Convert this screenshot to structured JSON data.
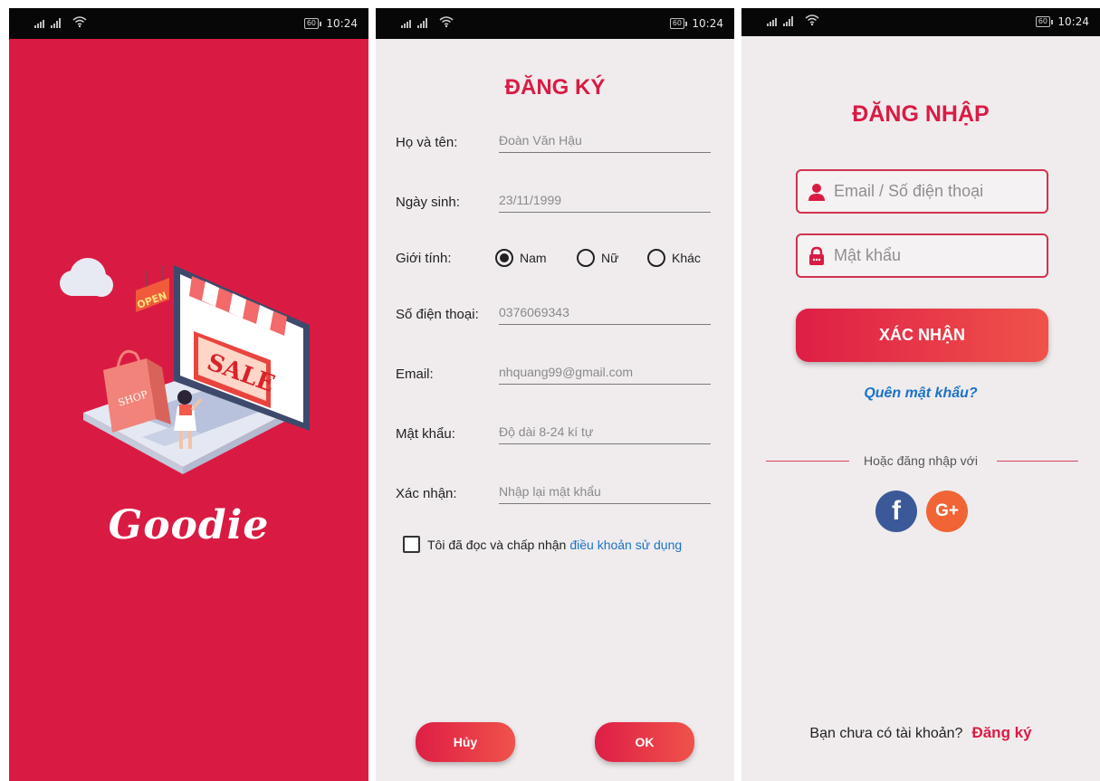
{
  "status": {
    "time": "10:24",
    "battery": "60"
  },
  "splash": {
    "brand": "Goodie",
    "sign_open": "OPEN",
    "sign_sale": "SALE",
    "bag_label": "SHOP"
  },
  "register": {
    "title": "ĐĂNG KÝ",
    "fields": [
      {
        "label": "Họ và tên:",
        "value": "Đoàn Văn Hậu"
      },
      {
        "label": "Ngày sinh:",
        "value": "23/11/1999"
      },
      {
        "label": "Số điện thoại:",
        "value": "0376069343"
      },
      {
        "label": "Email:",
        "value": "nhquang99@gmail.com"
      },
      {
        "label": "Mật khẩu:",
        "value": "Độ dài 8-24 kí tự"
      },
      {
        "label": "Xác nhận:",
        "value": "Nhập lại mật khẩu"
      }
    ],
    "gender_label": "Giới tính:",
    "gender_options": [
      "Nam",
      "Nữ",
      "Khác"
    ],
    "terms_text": "Tôi đã đọc và chấp nhận",
    "terms_link": "điều khoản sử dụng",
    "cancel_label": "Hủy",
    "ok_label": "OK"
  },
  "login": {
    "title": "ĐĂNG NHẬP",
    "email_placeholder": "Email / Số điện thoại",
    "password_placeholder": "Mật khẩu",
    "submit_label": "XÁC NHẬN",
    "forgot_label": "Quên mật khẩu?",
    "or_label": "Hoặc đăng nhập với",
    "facebook_label": "f",
    "google_label": "G+",
    "no_account": "Bạn chưa có tài khoản?",
    "register_link": "Đăng ký"
  },
  "colors": {
    "primary": "#d91b44",
    "link": "#1a73c8",
    "background": "#f0eced",
    "facebook": "#3b5998",
    "google": "#f06436"
  }
}
